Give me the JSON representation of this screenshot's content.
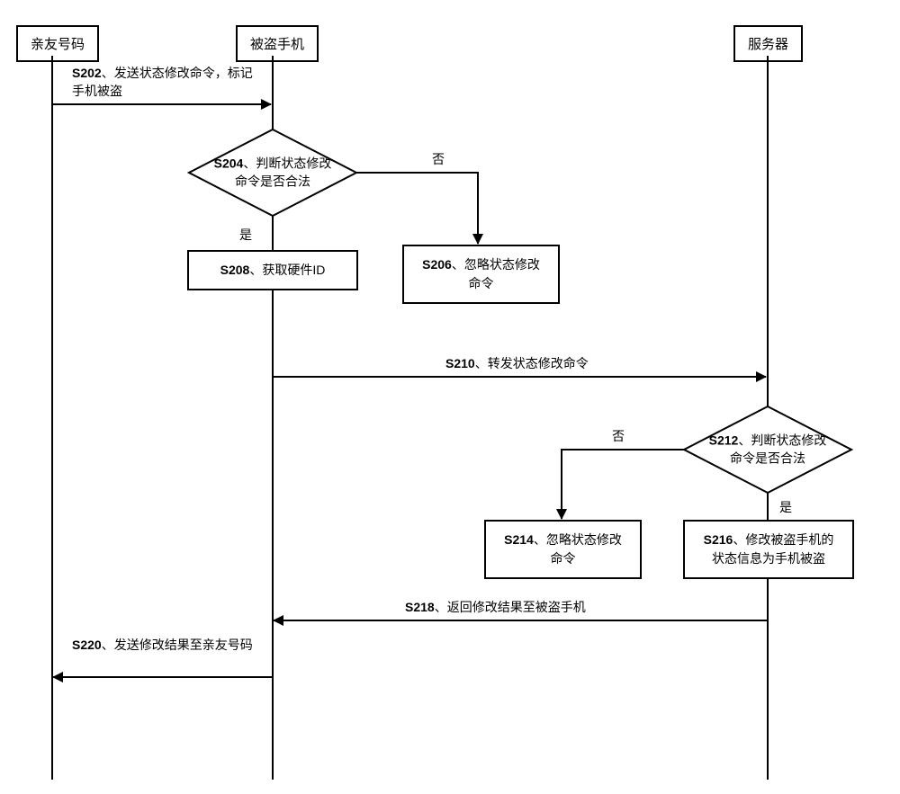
{
  "actors": {
    "friend": "亲友号码",
    "stolen": "被盗手机",
    "server": "服务器"
  },
  "steps": {
    "s202": {
      "id": "S202",
      "text": "、发送状态修改命令，标记手机被盗"
    },
    "s204": {
      "id": "S204",
      "text": "、判断状态修改命令是否合法"
    },
    "s206": {
      "id": "S206",
      "text": "、忽略状态修改命令"
    },
    "s208": {
      "id": "S208",
      "text": "、获取硬件ID"
    },
    "s210": {
      "id": "S210",
      "text": "、转发状态修改命令"
    },
    "s212": {
      "id": "S212",
      "text": "、判断状态修改命令是否合法"
    },
    "s214": {
      "id": "S214",
      "text": "、忽略状态修改命令"
    },
    "s216": {
      "id": "S216",
      "text": "、修改被盗手机的状态信息为手机被盗"
    },
    "s218": {
      "id": "S218",
      "text": "、返回修改结果至被盗手机"
    },
    "s220": {
      "id": "S220",
      "text": "、发送修改结果至亲友号码"
    }
  },
  "branches": {
    "yes": "是",
    "no": "否"
  }
}
